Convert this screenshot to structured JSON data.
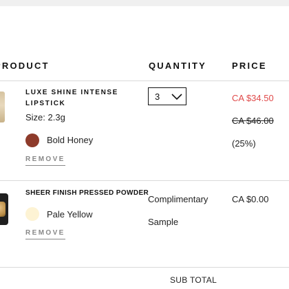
{
  "headers": {
    "product": "PRODUCT",
    "quantity": "QUANTITY",
    "price": "PRICE"
  },
  "items": [
    {
      "name": "LUXE SHINE INTENSE LIPSTICK",
      "size": "Size: 2.3g",
      "shade": "Bold Honey",
      "shade_color": "#8e3b2b",
      "remove_label": "REMOVE",
      "quantity": "3",
      "price_sale": "CA $34.50",
      "price_original": "CA $46.00",
      "discount": "(25%)"
    },
    {
      "name": "SHEER FINISH PRESSED POWDER",
      "shade": "Pale Yellow",
      "shade_color": "#fdf3d4",
      "remove_label": "REMOVE",
      "quantity_line1": "Complimentary",
      "quantity_line2": "Sample",
      "price": "CA $0.00"
    }
  ],
  "summary": {
    "subtotal_label": "SUB TOTAL"
  },
  "colors": {
    "sale": "#e04a4a",
    "rule": "#d9d9d9"
  },
  "icons": {
    "quantity_dropdown": "chevron-down-icon"
  }
}
